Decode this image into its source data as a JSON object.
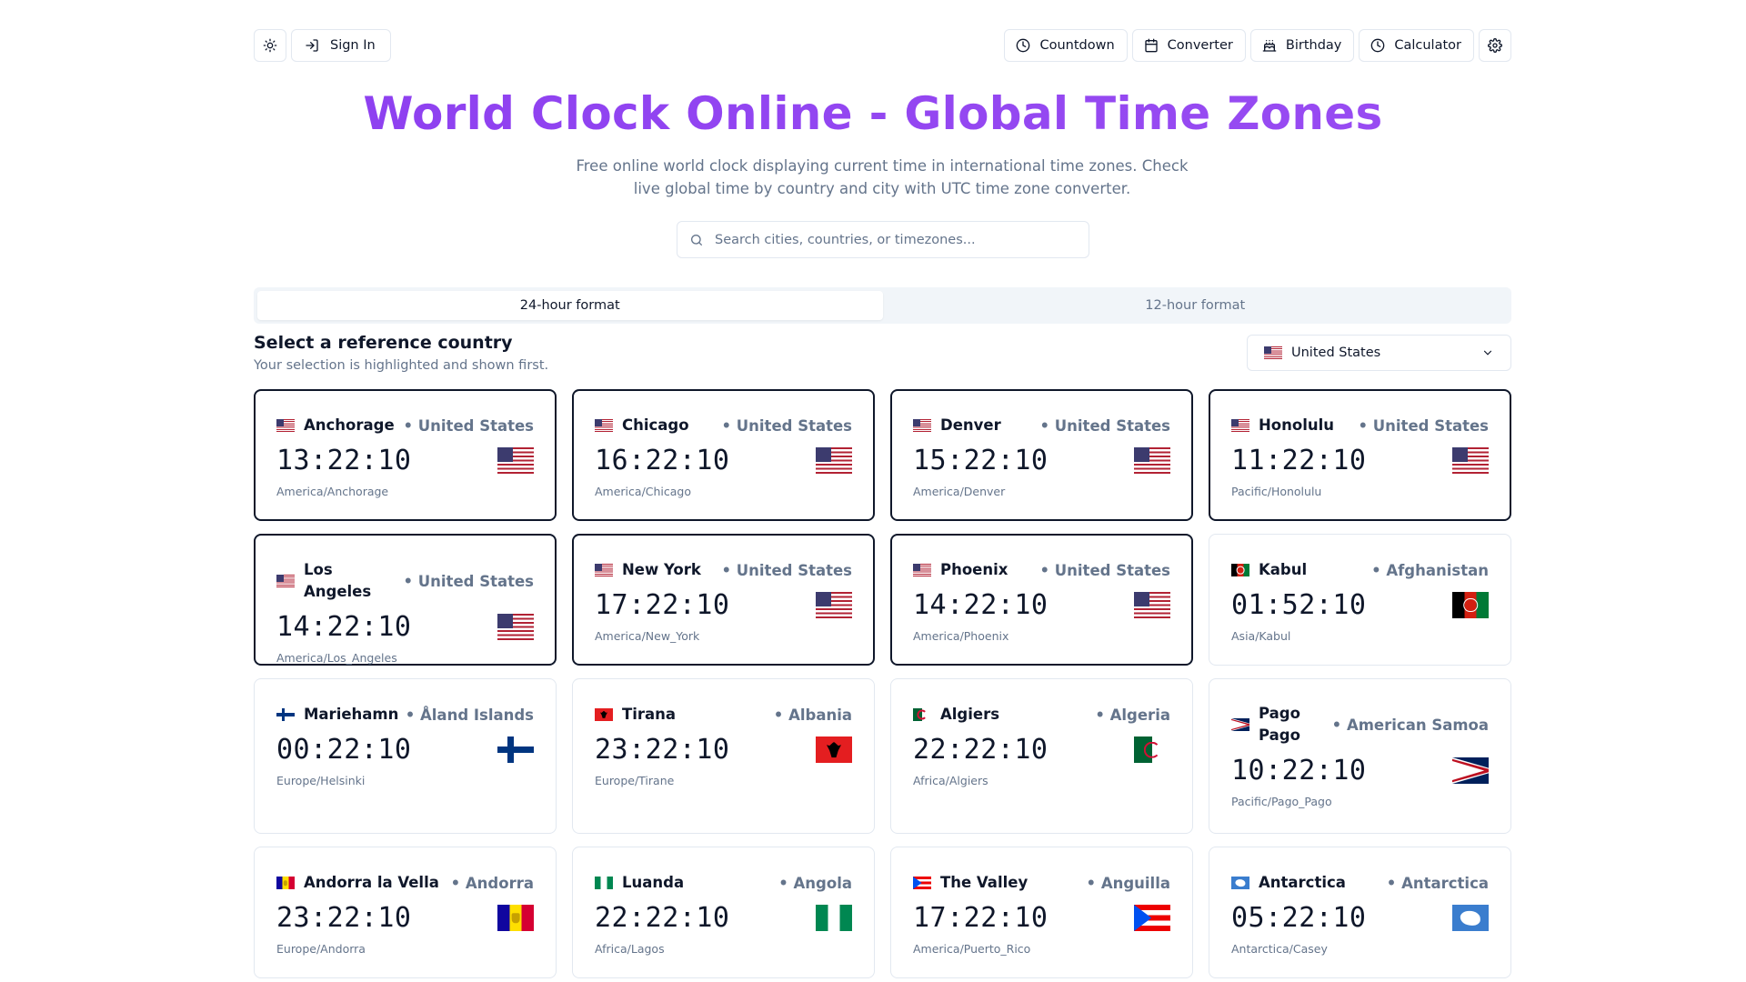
{
  "header": {
    "sign_in": "Sign In",
    "nav": [
      "Countdown",
      "Converter",
      "Birthday",
      "Calculator"
    ],
    "title": "World Clock Online - Global Time Zones",
    "subtitle": "Free online world clock displaying current time in international time zones. Check live global time by country and city with UTC time zone converter."
  },
  "search": {
    "placeholder": "Search cities, countries, or timezones...",
    "value": ""
  },
  "tabs": [
    "24-hour format",
    "12-hour format"
  ],
  "active_tab": 0,
  "reference": {
    "title": "Select a reference country",
    "subtitle": "Your selection is highlighted and shown first.",
    "selected": "United States"
  },
  "icons": {
    "theme": "sun-icon",
    "sign_in": "log-in-icon",
    "countdown": "clock-icon",
    "converter": "calendar-icon",
    "birthday": "cake-icon",
    "calculator": "clock-icon",
    "settings": "gear-icon",
    "search": "search-icon",
    "select": "chevron-down-icon"
  },
  "cards": [
    {
      "city": "Anchorage",
      "country": "• United States",
      "time": "13:22:10",
      "tz": "America/Anchorage",
      "flag": "us",
      "selected": true
    },
    {
      "city": "Chicago",
      "country": "• United States",
      "time": "16:22:10",
      "tz": "America/Chicago",
      "flag": "us",
      "selected": true
    },
    {
      "city": "Denver",
      "country": "• United States",
      "time": "15:22:10",
      "tz": "America/Denver",
      "flag": "us",
      "selected": true
    },
    {
      "city": "Honolulu",
      "country": "• United States",
      "time": "11:22:10",
      "tz": "Pacific/Honolulu",
      "flag": "us",
      "selected": true
    },
    {
      "city": "Los Angeles",
      "country": "• United States",
      "time": "14:22:10",
      "tz": "America/Los_Angeles",
      "flag": "us",
      "selected": true
    },
    {
      "city": "New York",
      "country": "• United States",
      "time": "17:22:10",
      "tz": "America/New_York",
      "flag": "us",
      "selected": true
    },
    {
      "city": "Phoenix",
      "country": "• United States",
      "time": "14:22:10",
      "tz": "America/Phoenix",
      "flag": "us",
      "selected": true
    },
    {
      "city": "Kabul",
      "country": "• Afghanistan",
      "time": "01:52:10",
      "tz": "Asia/Kabul",
      "flag": "af",
      "selected": false
    },
    {
      "city": "Mariehamn",
      "country": "• Åland Islands",
      "time": "00:22:10",
      "tz": "Europe/Helsinki",
      "flag": "fi",
      "selected": false
    },
    {
      "city": "Tirana",
      "country": "• Albania",
      "time": "23:22:10",
      "tz": "Europe/Tirane",
      "flag": "al",
      "selected": false
    },
    {
      "city": "Algiers",
      "country": "• Algeria",
      "time": "22:22:10",
      "tz": "Africa/Algiers",
      "flag": "dz",
      "selected": false
    },
    {
      "city": "Pago Pago",
      "country": "• American Samoa",
      "time": "10:22:10",
      "tz": "Pacific/Pago_Pago",
      "flag": "as",
      "selected": false
    },
    {
      "city": "Andorra la Vella",
      "country": "• Andorra",
      "time": "23:22:10",
      "tz": "Europe/Andorra",
      "flag": "ad",
      "selected": false
    },
    {
      "city": "Luanda",
      "country": "• Angola",
      "time": "22:22:10",
      "tz": "Africa/Lagos",
      "flag": "ng",
      "selected": false
    },
    {
      "city": "The Valley",
      "country": "• Anguilla",
      "time": "17:22:10",
      "tz": "America/Puerto_Rico",
      "flag": "pr",
      "selected": false
    },
    {
      "city": "Antarctica",
      "country": "• Antarctica",
      "time": "05:22:10",
      "tz": "Antarctica/Casey",
      "flag": "aq",
      "selected": false
    }
  ]
}
